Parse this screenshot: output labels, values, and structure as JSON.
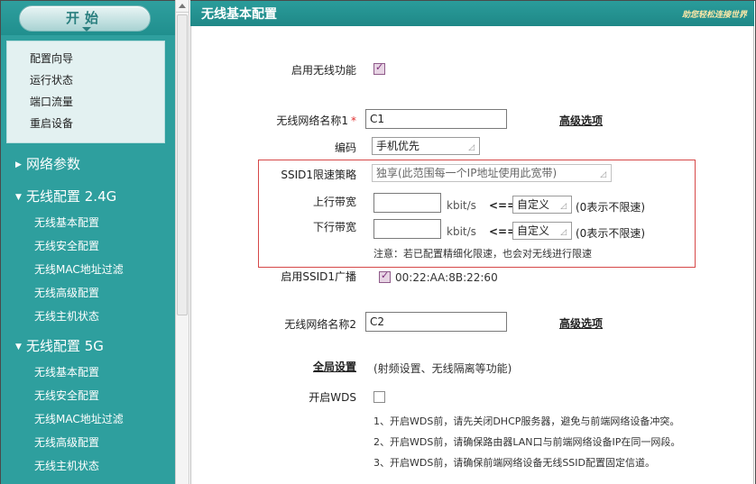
{
  "sidebar": {
    "start_label": "开始",
    "system_items": [
      "配置向导",
      "运行状态",
      "端口流量",
      "重启设备"
    ],
    "network_params": {
      "label": "网络参数"
    },
    "wireless_24g": {
      "label": "无线配置 2.4G",
      "items": [
        "无线基本配置",
        "无线安全配置",
        "无线MAC地址过滤",
        "无线高级配置",
        "无线主机状态"
      ]
    },
    "wireless_5g": {
      "label": "无线配置 5G",
      "items": [
        "无线基本配置",
        "无线安全配置",
        "无线MAC地址过滤",
        "无线高级配置",
        "无线主机状态"
      ]
    }
  },
  "header": {
    "title": "无线基本配置",
    "help_text": "助您轻松连接世界"
  },
  "form": {
    "enable_wireless": {
      "label": "启用无线功能",
      "checked": true
    },
    "ssid1": {
      "label": "无线网络名称1",
      "required_mark": "*",
      "value": "C1",
      "advanced_link": "高级选项"
    },
    "encoding": {
      "label": "编码",
      "value": "手机优先"
    },
    "rate_limit": {
      "policy_label": "SSID1限速策略",
      "policy_value": "独享(此范围每一个IP地址使用此宽带)",
      "up_label": "上行带宽",
      "down_label": "下行带宽",
      "unit": "kbit/s",
      "arrow": "<==",
      "mode_value": "自定义",
      "zero_hint": "(0表示不限速)",
      "note": "注意：若已配置精细化限速，也会对无线进行限速"
    },
    "ssid1_broadcast": {
      "label": "启用SSID1广播",
      "checked": true,
      "mac": "00:22:AA:8B:22:60"
    },
    "ssid2": {
      "label": "无线网络名称2",
      "value": "C2",
      "advanced_link": "高级选项"
    },
    "global": {
      "label": "全局设置",
      "desc": "(射频设置、无线隔离等功能)"
    },
    "wds": {
      "label": "开启WDS",
      "checked": false,
      "notes": [
        "1、开启WDS前，请先关闭DHCP服务器，避免与前端网络设备冲突。",
        "2、开启WDS前，请确保路由器LAN口与前端网络设备IP在同一网段。",
        "3、开启WDS前，请确保前端网络设备无线SSID配置固定信道。"
      ]
    }
  },
  "colors": {
    "sidebar_bg": "#2e9f9e",
    "accent": "#1f8887",
    "highlight_border": "#d64848"
  }
}
